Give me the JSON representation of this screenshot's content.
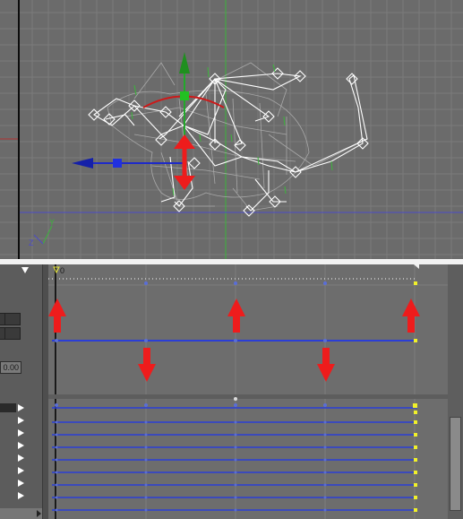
{
  "viewport": {
    "axis_label": "Y",
    "axis_label_z": "Z"
  },
  "trackview": {
    "time_label": "0",
    "value_field": "0.00",
    "track_rows": 8
  },
  "colors": {
    "key_up_arrow": "#ee1c1c",
    "key_down_arrow": "#ee1c1c",
    "curve": "#2b3ed6",
    "key_dot": "#5a6ed6",
    "end_key": "#f0f02a",
    "grid": "#858585",
    "gizmo_x": "#1e2ac8",
    "gizmo_y": "#22a82a",
    "gizmo_rot": "#cc1a1a",
    "bones": "#ffffff"
  }
}
